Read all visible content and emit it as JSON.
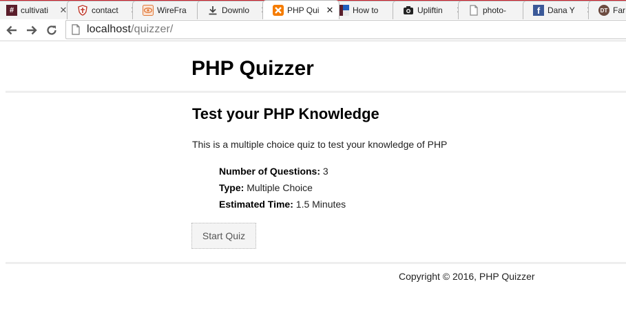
{
  "browser": {
    "tabs": [
      {
        "title": "cultivati",
        "icon": "hash-icon",
        "color": "#5a1e2b"
      },
      {
        "title": "contact",
        "icon": "shield-icon",
        "color": "#c0392b"
      },
      {
        "title": "WireFra",
        "icon": "eye-icon",
        "color": "#e07a3a"
      },
      {
        "title": "Downlo",
        "icon": "download-icon",
        "color": "#444444"
      },
      {
        "title": "PHP Qui",
        "icon": "xampp-icon",
        "color": "#f57c00",
        "active": true
      },
      {
        "title": "How to",
        "icon": "blog-icon",
        "color": "#5a1e2b"
      },
      {
        "title": "Upliftin",
        "icon": "camera-icon",
        "color": "#222222"
      },
      {
        "title": "photo-",
        "icon": "page-icon",
        "color": "#888888"
      },
      {
        "title": "Dana Y",
        "icon": "facebook-icon",
        "color": "#3b5998"
      },
      {
        "title": "Far",
        "icon": "dt-icon",
        "color": "#6d4c41",
        "badge": "DT"
      }
    ],
    "close_glyph": "✕",
    "address": {
      "host": "localhost",
      "path": "/quizzer/"
    }
  },
  "page": {
    "site_title": "PHP Quizzer",
    "heading": "Test your PHP Knowledge",
    "intro": "This is a multiple choice quiz to test your knowledge of PHP",
    "info": [
      {
        "label": "Number of Questions:",
        "value": " 3"
      },
      {
        "label": "Type:",
        "value": " Multiple Choice"
      },
      {
        "label": "Estimated Time:",
        "value": " 1.5 Minutes"
      }
    ],
    "start_label": "Start Quiz",
    "footer": "Copyright © 2016, PHP Quizzer"
  }
}
